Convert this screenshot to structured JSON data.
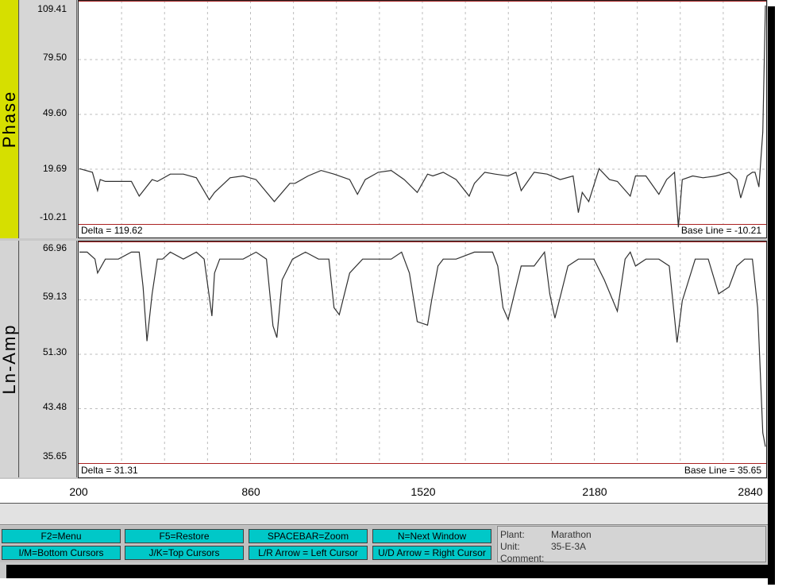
{
  "panels": {
    "phase": {
      "label": "Phase",
      "ticks": [
        "109.41",
        "79.50",
        "49.60",
        "19.69",
        "-10.21"
      ],
      "delta": "Delta = 119.62",
      "baseline": "Base Line = -10.21"
    },
    "amp": {
      "label": "Ln-Amp",
      "ticks": [
        "66.96",
        "59.13",
        "51.30",
        "43.48",
        "35.65"
      ],
      "delta": "Delta = 31.31",
      "baseline": "Base Line = 35.65"
    }
  },
  "xaxis": {
    "ticks": [
      "200",
      "860",
      "1520",
      "2180",
      "2840"
    ]
  },
  "buttons": {
    "menu": "F2=Menu",
    "restore": "F5=Restore",
    "zoom": "SPACEBAR=Zoom",
    "next_window": "N=Next Window",
    "bottom_cursors": "I/M=Bottom Cursors",
    "top_cursors": "J/K=Top Cursors",
    "left_cursor": "L/R Arrow = Left Cursor",
    "right_cursor": "U/D Arrow = Right Cursor"
  },
  "info": {
    "plant_label": "Plant:",
    "plant_value": "Marathon",
    "unit_label": "Unit:",
    "unit_value": "35-E-3A",
    "comment_label": "Comment:"
  },
  "colors": {
    "phase_tab": "#d6df00",
    "button": "#00c8c8",
    "baseline_line": "#aa2222",
    "trace": "#303030"
  },
  "chart_data": [
    {
      "type": "line",
      "title": "",
      "ylabel": "Phase",
      "xlim": [
        200,
        2840
      ],
      "ylim": [
        -10.21,
        109.41
      ],
      "grid": true,
      "series": [
        {
          "x": [
            200,
            250,
            270,
            280,
            300,
            350,
            400,
            430,
            480,
            500,
            550,
            600,
            650,
            700,
            720,
            780,
            830,
            880,
            950,
            1010,
            1030,
            1080,
            1130,
            1180,
            1240,
            1270,
            1300,
            1350,
            1400,
            1450,
            1500,
            1540,
            1560,
            1600,
            1650,
            1700,
            1720,
            1760,
            1800,
            1850,
            1880,
            1900,
            1950,
            2000,
            2050,
            2100,
            2120,
            2135,
            2160,
            2200,
            2240,
            2270,
            2320,
            2340,
            2380,
            2430,
            2460,
            2490,
            2505,
            2520,
            2560,
            2600,
            2650,
            2700,
            2730,
            2745,
            2770,
            2790,
            2800,
            2815,
            2830,
            2840
          ],
          "y": [
            20,
            18,
            8,
            14,
            13,
            13,
            13,
            5,
            14,
            13,
            17,
            17,
            15,
            3,
            7,
            15,
            16,
            14,
            2,
            12,
            12,
            16,
            19,
            17,
            14,
            6,
            14,
            18,
            19,
            14,
            7,
            17,
            16,
            18,
            14,
            5,
            12,
            18,
            17,
            16,
            18,
            8,
            18,
            17,
            14,
            16,
            -4,
            7,
            2,
            20,
            14,
            13,
            5,
            16,
            16,
            6,
            14,
            18,
            -12,
            14,
            16,
            15,
            16,
            18,
            14,
            4,
            16,
            18,
            18,
            10,
            40,
            109
          ]
        }
      ]
    },
    {
      "type": "line",
      "title": "",
      "ylabel": "Ln-Amp",
      "xlim": [
        200,
        2840
      ],
      "ylim": [
        35.65,
        66.96
      ],
      "grid": true,
      "series": [
        {
          "x": [
            200,
            230,
            260,
            270,
            300,
            350,
            400,
            430,
            445,
            460,
            480,
            500,
            520,
            550,
            600,
            650,
            680,
            710,
            720,
            740,
            780,
            830,
            880,
            920,
            945,
            960,
            980,
            1020,
            1070,
            1120,
            1160,
            1180,
            1200,
            1240,
            1290,
            1350,
            1400,
            1440,
            1470,
            1500,
            1540,
            1555,
            1580,
            1600,
            1650,
            1720,
            1790,
            1810,
            1830,
            1850,
            1900,
            1950,
            1990,
            2010,
            2030,
            2080,
            2120,
            2160,
            2180,
            2220,
            2270,
            2300,
            2320,
            2340,
            2380,
            2430,
            2470,
            2500,
            2520,
            2570,
            2620,
            2660,
            2700,
            2730,
            2760,
            2790,
            2810,
            2830,
            2840
          ],
          "y": [
            66,
            66,
            65,
            63,
            65,
            65,
            66,
            66,
            61,
            53.2,
            60,
            65,
            65,
            66,
            65,
            66,
            65,
            56.8,
            63,
            65,
            65,
            65,
            66,
            65,
            55.4,
            53.7,
            62,
            65,
            66,
            65,
            65,
            58,
            57,
            63,
            65,
            65,
            65,
            66,
            63,
            56,
            55.5,
            59,
            64,
            65,
            65,
            66,
            66,
            64,
            58,
            56.3,
            64,
            64,
            66,
            60,
            56.5,
            64,
            65,
            65,
            65,
            62,
            57.5,
            65,
            66,
            64,
            65,
            65,
            64,
            53,
            59,
            65,
            65,
            60,
            61,
            64,
            65,
            65,
            58,
            40,
            38
          ]
        }
      ]
    }
  ]
}
